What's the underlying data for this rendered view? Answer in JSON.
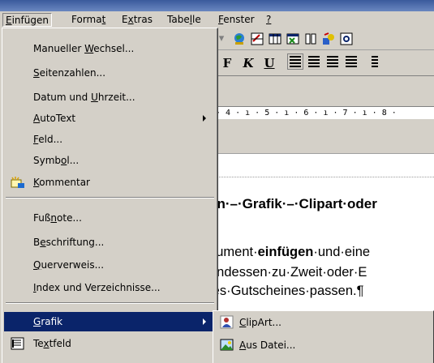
{
  "menubar": {
    "items": [
      {
        "pre": "",
        "key": "E",
        "post": "infügen"
      },
      {
        "pre": "Forma",
        "key": "t",
        "post": ""
      },
      {
        "pre": "E",
        "key": "x",
        "post": "tras"
      },
      {
        "pre": "Tabe",
        "key": "l",
        "post": "le"
      },
      {
        "pre": "",
        "key": "F",
        "post": "enster"
      },
      {
        "pre": "",
        "key": "?",
        "post": ""
      }
    ]
  },
  "menu": {
    "items": [
      {
        "pre": "Manueller ",
        "key": "W",
        "post": "echsel..."
      },
      {
        "pre": "",
        "key": "S",
        "post": "eitenzahlen..."
      },
      {
        "pre": "Datum und ",
        "key": "U",
        "post": "hrzeit..."
      },
      {
        "pre": "",
        "key": "A",
        "post": "utoText"
      },
      {
        "pre": "",
        "key": "F",
        "post": "eld..."
      },
      {
        "pre": "Symb",
        "key": "o",
        "post": "l..."
      },
      {
        "pre": "",
        "key": "K",
        "post": "ommentar"
      },
      {
        "pre": "Fuß",
        "key": "n",
        "post": "ote..."
      },
      {
        "pre": "B",
        "key": "e",
        "post": "schriftung..."
      },
      {
        "pre": "",
        "key": "Q",
        "post": "uerverweis..."
      },
      {
        "pre": "",
        "key": "I",
        "post": "ndex und Verzeichnisse..."
      },
      {
        "pre": "",
        "key": "G",
        "post": "rafik"
      },
      {
        "pre": "Te",
        "key": "x",
        "post": "tfeld"
      }
    ]
  },
  "submenu": {
    "items": [
      {
        "pre": "",
        "key": "C",
        "post": "lipArt..."
      },
      {
        "pre": "",
        "key": "A",
        "post": "us Datei..."
      }
    ]
  },
  "toolbar": {
    "bold": "F",
    "italic": "K",
    "underline": "U",
    "ruler_text": "· 4 · ı · 5 · ı · 6 · ı · 7 · ı · 8 ·"
  },
  "document": {
    "heading": "en·–·Grafik·–·Clipart·oder",
    "line1_pre": "kument·",
    "line1_bold": "einfügen",
    "line1_post": "·und·eine",
    "line2": "endessen·zu·Zweit·oder·E",
    "line3": "les·Gutscheines·passen.¶"
  }
}
